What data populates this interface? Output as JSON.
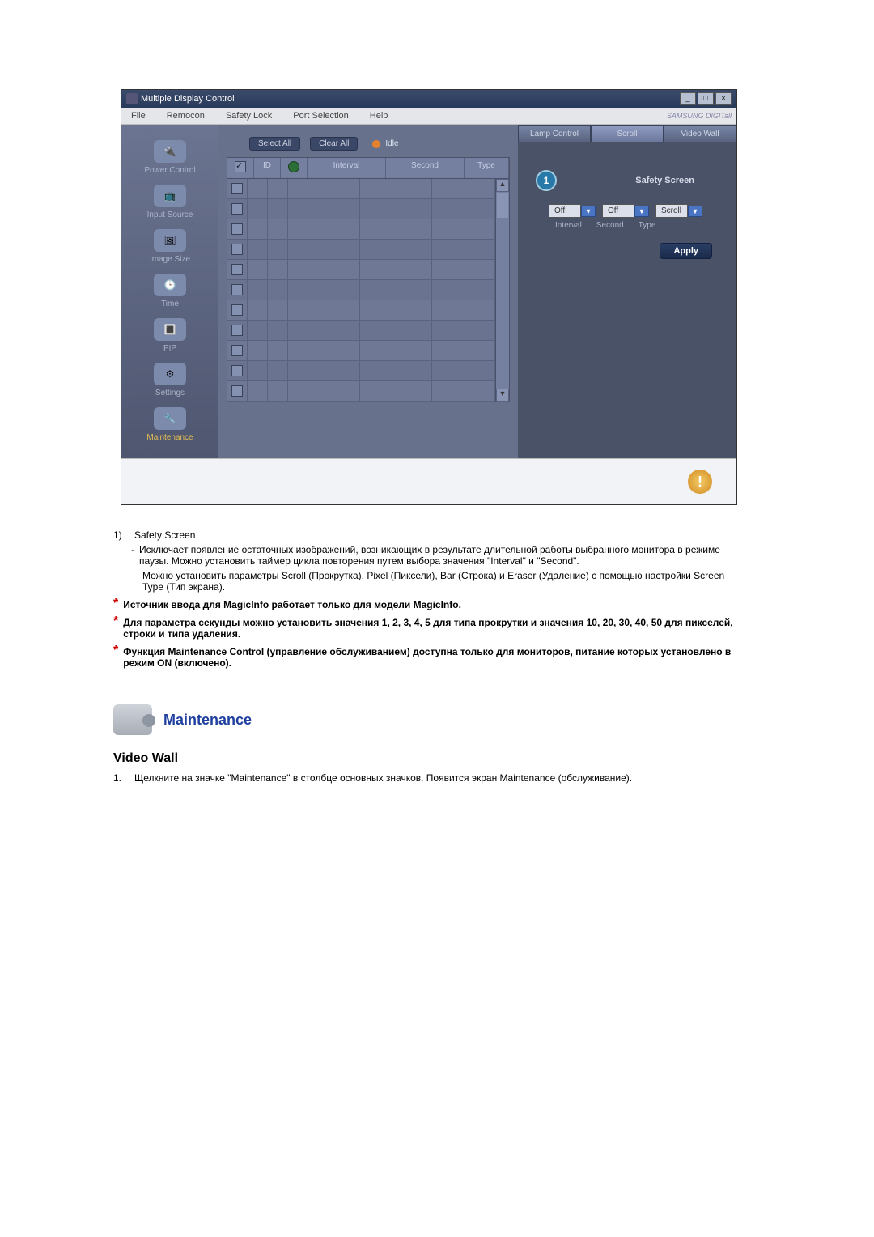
{
  "app": {
    "title": "Multiple Display Control",
    "menubar": [
      "File",
      "Remocon",
      "Safety Lock",
      "Port Selection",
      "Help"
    ],
    "brand": "SAMSUNG DIGITall"
  },
  "sidebar": {
    "items": [
      {
        "label": "Power Control"
      },
      {
        "label": "Input Source"
      },
      {
        "label": "Image Size"
      },
      {
        "label": "Time"
      },
      {
        "label": "PIP"
      },
      {
        "label": "Settings"
      },
      {
        "label": "Maintenance"
      }
    ]
  },
  "center": {
    "select_all": "Select All",
    "clear_all": "Clear All",
    "idle": "Idle",
    "columns": {
      "id": "ID",
      "interval": "Interval",
      "second": "Second",
      "type": "Type"
    }
  },
  "detail": {
    "tabs": [
      "Lamp Control",
      "Scroll",
      "Video Wall"
    ],
    "group_label": "Safety Screen",
    "interval": "Off",
    "second": "Off",
    "type": "Scroll",
    "sub_interval": "Interval",
    "sub_second": "Second",
    "sub_type": "Type",
    "apply": "Apply",
    "circle": "1"
  },
  "doc": {
    "item_num": "1)",
    "item_title": "Safety Screen",
    "bullet_dash": "-",
    "item_desc1": "Исключает появление остаточных изображений, возникающих в результате длительной работы выбранного монитора в режиме паузы. Можно установить таймер цикла повторения путем выбора значения \"Interval\" и \"Second\".",
    "item_desc2": "Можно установить параметры Scroll (Прокрутка), Pixel (Пиксели), Bar (Строка) и Eraser (Удаление) с помощью настройки Screen Type (Тип экрана).",
    "note1": "Источник ввода для MagicInfo работает только для модели MagicInfo.",
    "note2": "Для параметра секунды можно установить значения 1, 2, 3, 4, 5 для типа прокрутки и значения 10, 20, 30, 40, 50 для пикселей, строки и типа удаления.",
    "note3": "Функция Maintenance Control (управление обслуживанием) доступна только для мониторов, питание которых установлено в режим ON (включено).",
    "section_title": "Maintenance",
    "subhead": "Video Wall",
    "list1_num": "1.",
    "list1": "Щелкните на значке \"Maintenance\" в столбце основных значков. Появится экран Maintenance (обслуживание)."
  }
}
